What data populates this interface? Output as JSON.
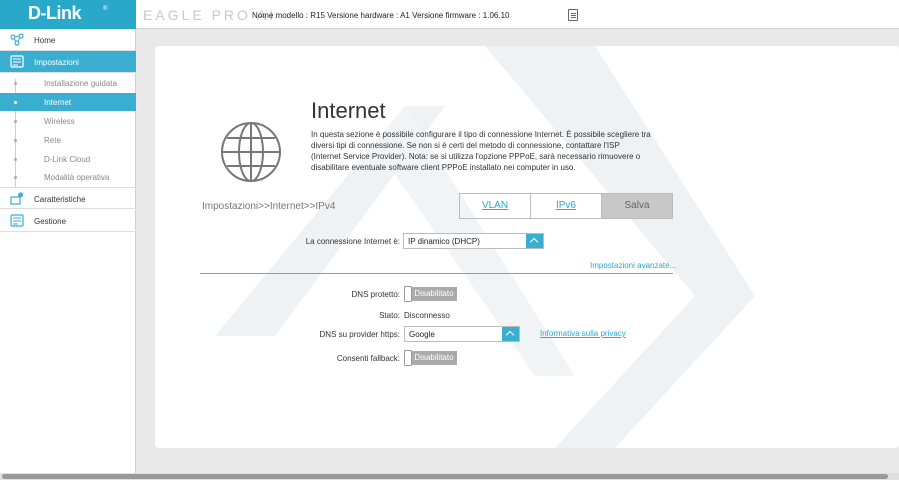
{
  "header": {
    "logo": "D-Link",
    "logo_reg": "®",
    "product": "EAGLE PRO AI",
    "model_info": "Nome modello : R15 Versione hardware : A1 Versione firmware : 1.06.10"
  },
  "sidebar": {
    "home": "Home",
    "settings": "Impostazioni",
    "sub_items": [
      "Installazione guidata",
      "Internet",
      "Wireless",
      "Rete",
      "D-Link Cloud",
      "Modalità operativa"
    ],
    "features": "Caratteristiche",
    "management": "Gestione"
  },
  "main": {
    "title": "Internet",
    "description": "In questa sezione è possibile configurare il tipo di connessione Internet. È possibile scegliere tra diversi tipi di connessione. Se non si è certi del metodo di connessione, contattare l'ISP (Internet Service Provider). Nota: se si utilizza l'opzione PPPoE, sarà necessario rimuovere o disabilitare eventuale software client PPPoE installato nei computer in uso.",
    "breadcrumb": "Impostazioni>>Internet>>IPv4",
    "tabs": {
      "vlan": "VLAN",
      "ipv6": "IPv6",
      "save": "Salva"
    },
    "connection_label": "La connessione Internet è:",
    "connection_value": "IP dinamico (DHCP)",
    "advanced_link": "Impostazioni avanzate...",
    "dns_protected_label": "DNS protetto:",
    "dns_protected_value": "Disabilitato",
    "status_label": "Stato:",
    "status_value": "Disconnesso",
    "dns_provider_label": "DNS su provider https:",
    "dns_provider_value": "Google",
    "privacy_link": "Informativa sulla privacy",
    "fallback_label": "Consenti fallback:",
    "fallback_value": "Disabilitato"
  },
  "colors": {
    "accent": "#3aaed0",
    "logo_bg": "#2aa8c9",
    "toggle_off": "#aaaaaa"
  }
}
